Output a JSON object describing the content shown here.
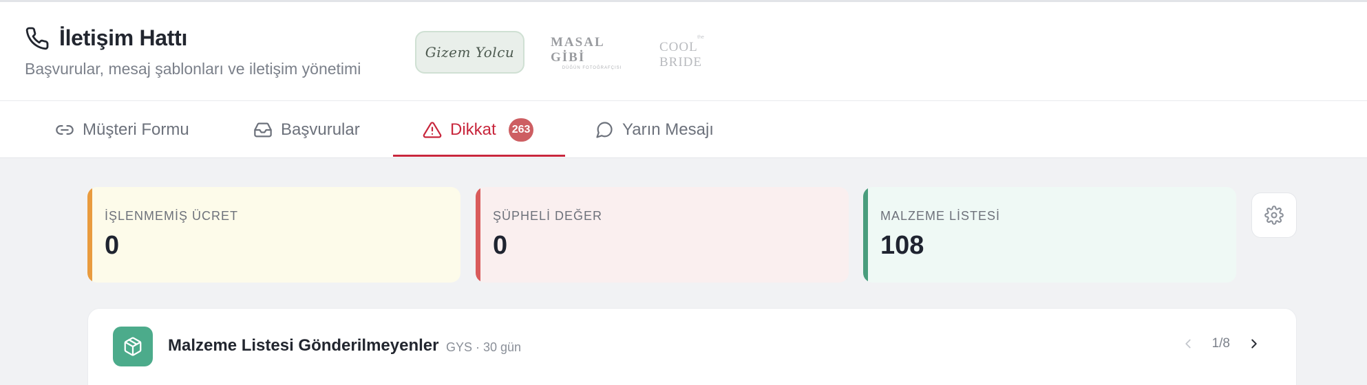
{
  "app": {
    "title": "İletişim Hattı",
    "subtitle": "Başvurular, mesaj şablonları ve iletişim yönetimi"
  },
  "brands": [
    {
      "name": "GizemYolcu",
      "line1": "Gizem Yolcu",
      "active": true
    },
    {
      "name": "Masal Gibi",
      "line1": "MASAL GİBİ",
      "line2": "DÜĞÜN FOTOĞRAFÇISI",
      "active": false
    },
    {
      "name": "The Cool Bride",
      "line1": "the",
      "line2": "COOL BRIDE",
      "active": false
    }
  ],
  "tabs": [
    {
      "label": "Müşteri Formu",
      "icon": "link-icon",
      "active": false
    },
    {
      "label": "Başvurular",
      "icon": "inbox-icon",
      "active": false
    },
    {
      "label": "Dikkat",
      "icon": "warning-icon",
      "active": true,
      "badge": "263"
    },
    {
      "label": "Yarın Mesajı",
      "icon": "message-icon",
      "active": false
    }
  ],
  "stats": [
    {
      "label": "İŞLENMEMİŞ ÜCRET",
      "value": "0",
      "color": "#e99b3e"
    },
    {
      "label": "ŞÜPHELİ DEĞER",
      "value": "0",
      "color": "#d95b5b"
    },
    {
      "label": "MALZEME LİSTESİ",
      "value": "108",
      "color": "#4a9d7d"
    }
  ],
  "settings": {
    "icon": "gear-icon"
  },
  "card": {
    "title": "Malzeme Listesi Gönderilmeyenler",
    "meta": "GYS · 30 gün",
    "icon": "box-icon",
    "page": "1/8"
  },
  "colors": {
    "accent": "#c8263c",
    "badge": "#cd5e62",
    "brand_green": "#4cab8b"
  }
}
